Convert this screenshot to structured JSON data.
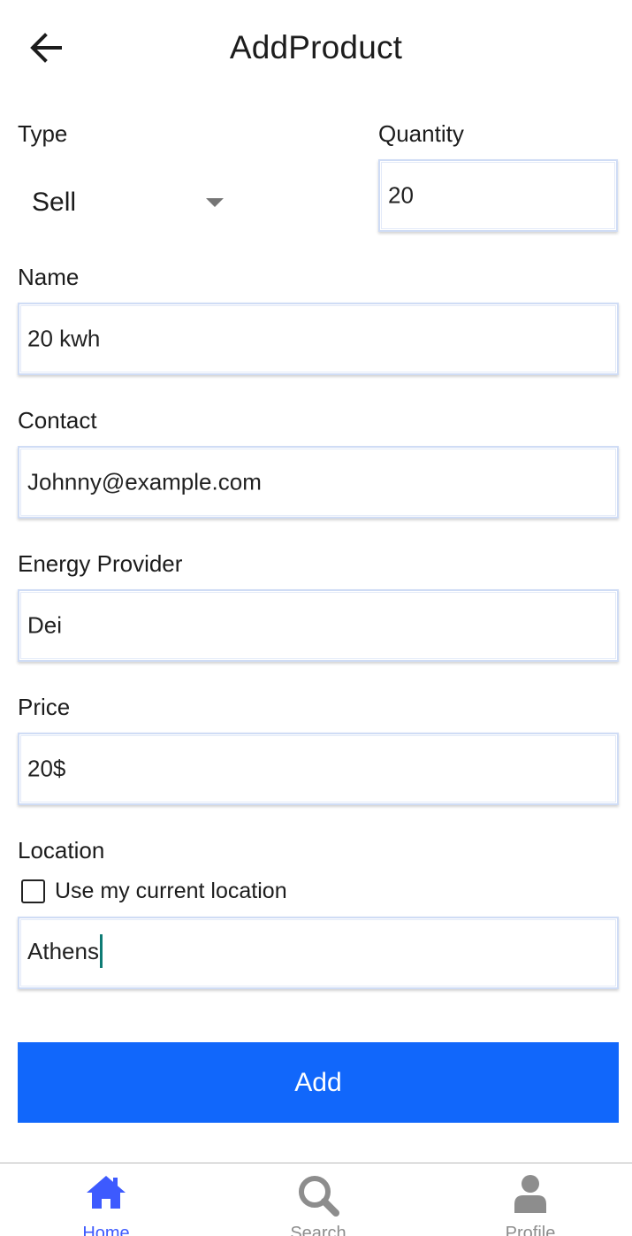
{
  "header": {
    "title": "AddProduct",
    "back_icon": "arrow-left-icon"
  },
  "form": {
    "type": {
      "label": "Type",
      "value": "Sell"
    },
    "quantity": {
      "label": "Quantity",
      "value": "20"
    },
    "name": {
      "label": "Name",
      "value": "20 kwh"
    },
    "contact": {
      "label": "Contact",
      "value": "Johnny@example.com"
    },
    "energy_provider": {
      "label": "Energy Provider",
      "value": "Dei"
    },
    "price": {
      "label": "Price",
      "value": "20$"
    },
    "location": {
      "label": "Location",
      "checkbox_label": "Use my current location",
      "checkbox_checked": false,
      "value": "Athens"
    },
    "submit_label": "Add"
  },
  "bottom_nav": {
    "items": [
      {
        "label": "Home",
        "icon": "home-icon",
        "active": true
      },
      {
        "label": "Search",
        "icon": "search-icon",
        "active": false
      },
      {
        "label": "Profile",
        "icon": "person-icon",
        "active": false
      }
    ]
  },
  "colors": {
    "primary_button": "#1167fb",
    "nav_active": "#3d5afe",
    "nav_inactive": "#8d8d8d",
    "field_border": "#cfdcf5",
    "caret": "#0f7c75"
  }
}
